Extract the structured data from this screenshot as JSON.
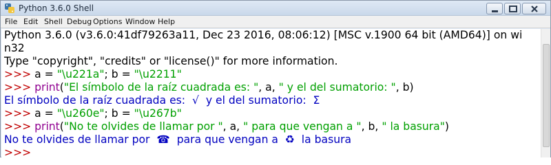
{
  "window": {
    "title": "Python 3.6.0 Shell",
    "icon": "python-icon"
  },
  "menu": [
    "File",
    "Edit",
    "Shell",
    "Debug",
    "Options",
    "Window",
    "Help"
  ],
  "window_buttons": {
    "minimize": "minimize-icon",
    "maximize": "maximize-icon",
    "close": "close-icon"
  },
  "shell": {
    "lines": [
      [
        {
          "t": "Python 3.6.0 (v3.6.0:41df79263a11, Dec 23 2016, 08:06:12) [MSC v.1900 64 bit (AMD64)] on wi",
          "c": "black"
        }
      ],
      [
        {
          "t": "n32",
          "c": "black"
        }
      ],
      [
        {
          "t": "Type \"copyright\", \"credits\" or \"license()\" for more information.",
          "c": "black"
        }
      ],
      [
        {
          "t": ">>> ",
          "c": "red"
        },
        {
          "t": "a = ",
          "c": "black"
        },
        {
          "t": "\"\\u221a\"",
          "c": "green"
        },
        {
          "t": "; b = ",
          "c": "black"
        },
        {
          "t": "\"\\u2211\"",
          "c": "green"
        }
      ],
      [
        {
          "t": ">>> ",
          "c": "red"
        },
        {
          "t": "print",
          "c": "purple"
        },
        {
          "t": "(",
          "c": "black"
        },
        {
          "t": "\"El símbolo de la raíz cuadrada es: \"",
          "c": "green"
        },
        {
          "t": ", a, ",
          "c": "black"
        },
        {
          "t": "\" y el del sumatorio: \"",
          "c": "green"
        },
        {
          "t": ", b)",
          "c": "black"
        }
      ],
      [
        {
          "t": "El símbolo de la raíz cuadrada es:  √  y el del sumatorio:  Σ",
          "c": "blue"
        }
      ],
      [
        {
          "t": ">>> ",
          "c": "red"
        },
        {
          "t": "a = ",
          "c": "black"
        },
        {
          "t": "\"\\u260e\"",
          "c": "green"
        },
        {
          "t": "; b = ",
          "c": "black"
        },
        {
          "t": "\"\\u267b\"",
          "c": "green"
        }
      ],
      [
        {
          "t": ">>> ",
          "c": "red"
        },
        {
          "t": "print",
          "c": "purple"
        },
        {
          "t": "(",
          "c": "black"
        },
        {
          "t": "\"No te olvides de llamar por \"",
          "c": "green"
        },
        {
          "t": ", a, ",
          "c": "black"
        },
        {
          "t": "\" para que vengan a \"",
          "c": "green"
        },
        {
          "t": ", b, ",
          "c": "black"
        },
        {
          "t": "\" la basura\"",
          "c": "green"
        },
        {
          "t": ")",
          "c": "black"
        }
      ],
      [
        {
          "t": "No te olvides de llamar por  ☎  para que vengan a  ♻  la basura",
          "c": "blue"
        }
      ],
      [
        {
          "t": ">>> ",
          "c": "red"
        }
      ]
    ]
  },
  "colors": {
    "prompt": "#c00000",
    "string": "#00a000",
    "builtin": "#900090",
    "output": "#0000c0"
  }
}
